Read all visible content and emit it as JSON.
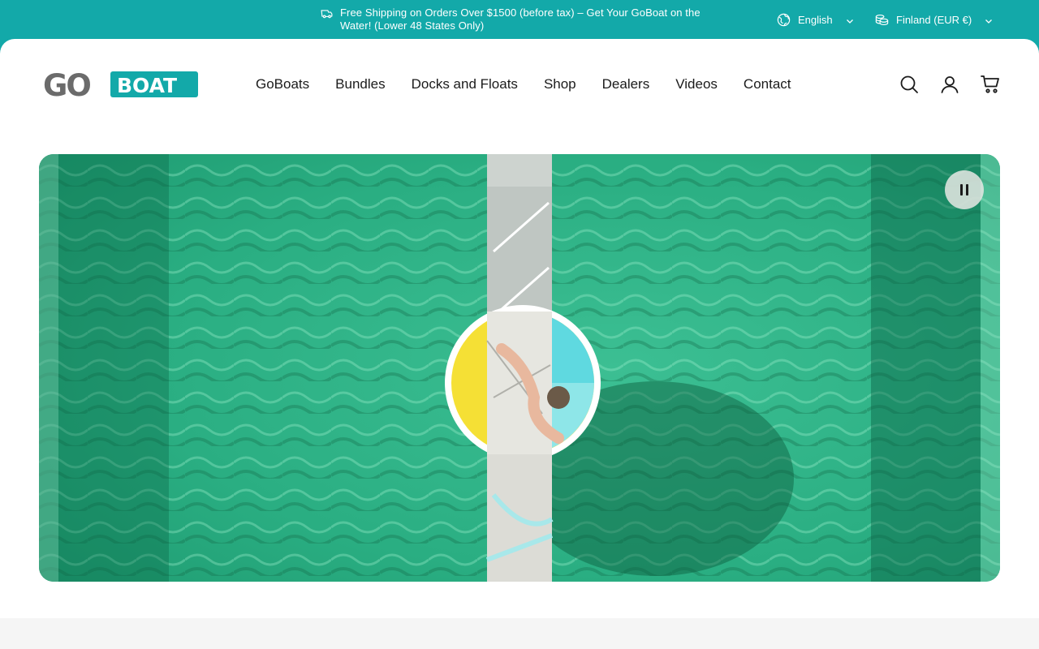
{
  "announcement": {
    "text": "Free Shipping on Orders Over $1500 (before tax) – Get Your GoBoat on the Water! (Lower 48 States Only)"
  },
  "language": {
    "selected": "English"
  },
  "country": {
    "selected": "Finland (EUR €)"
  },
  "brand": {
    "logo_part1": "GO",
    "logo_part2": "BOAT",
    "accent": "#13a9a9",
    "logo_gray": "#6b6b6b"
  },
  "nav": {
    "items": [
      "GoBoats",
      "Bundles",
      "Docks and Floats",
      "Shop",
      "Dealers",
      "Videos",
      "Contact"
    ]
  },
  "header_icons": [
    "search-icon",
    "account-icon",
    "cart-icon"
  ],
  "hero": {
    "control": "pause-icon"
  }
}
